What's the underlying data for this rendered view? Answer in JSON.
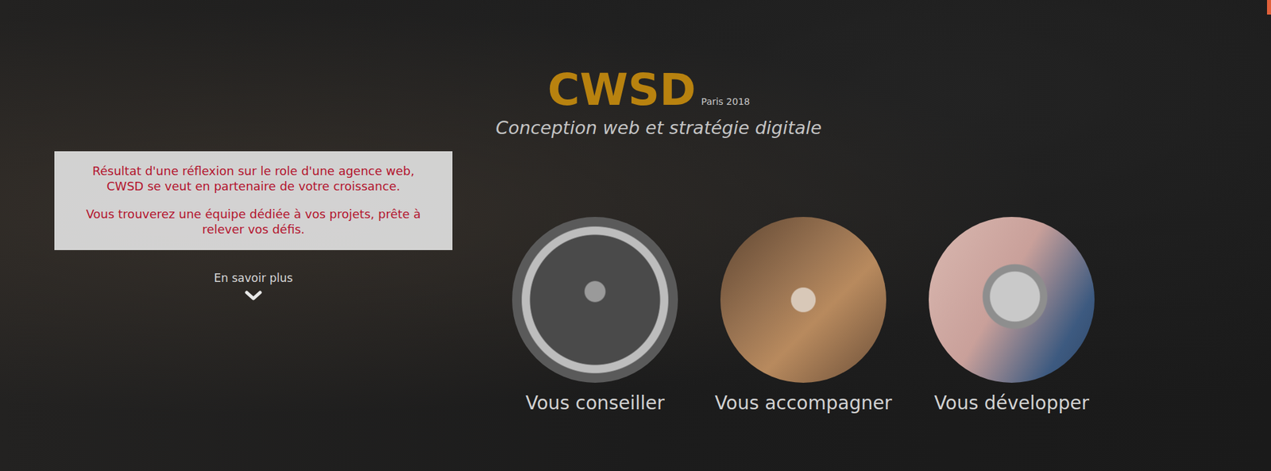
{
  "brand": {
    "title": "CWSD",
    "tagline": "Paris 2018",
    "subtitle": "Conception web et stratégie digitale"
  },
  "intro": {
    "paragraphs": [
      "Résultat d'une réflexion sur le role d'une agence web, CWSD se veut en partenaire de votre croissance.",
      "Vous trouverez une équipe dédiée à vos projets, prête à relever vos défis."
    ]
  },
  "more_link": {
    "label": "En savoir plus"
  },
  "services": [
    {
      "label": "Vous conseiller"
    },
    {
      "label": "Vous accompagner"
    },
    {
      "label": "Vous développer"
    }
  ]
}
